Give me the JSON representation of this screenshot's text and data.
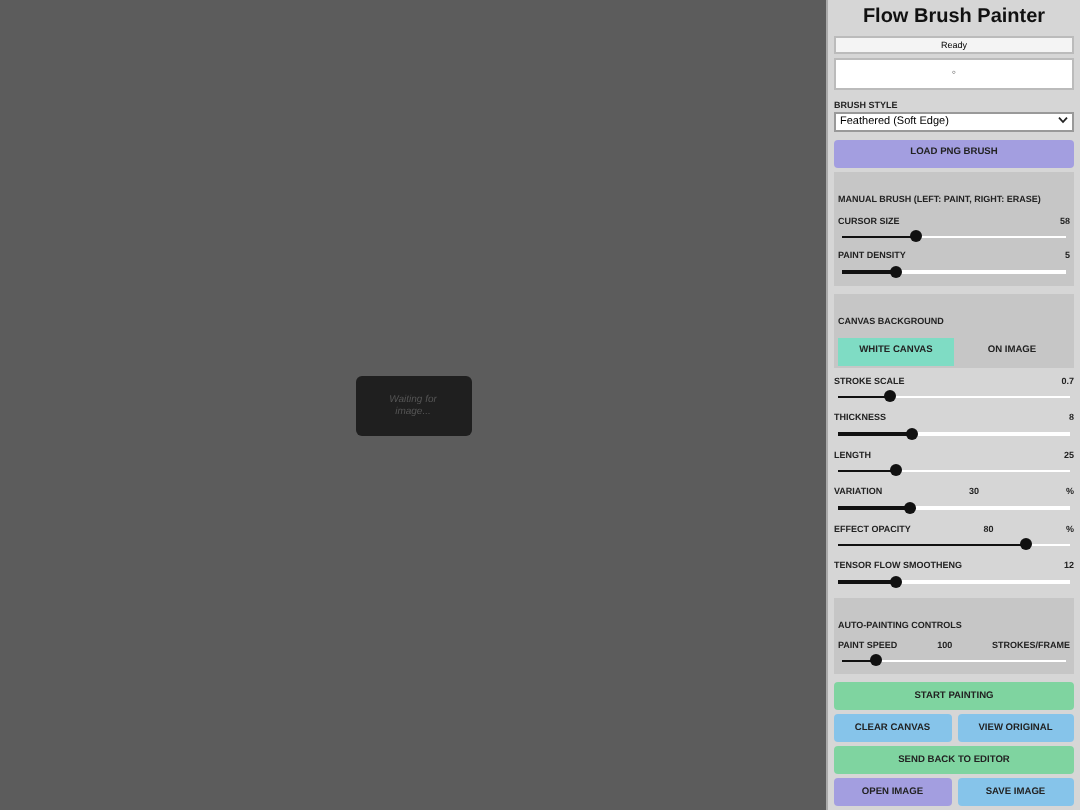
{
  "canvas": {
    "message": "Waiting for image..."
  },
  "panel": {
    "title": "Flow Brush Painter",
    "status": "Ready",
    "preview_symbol": "◦",
    "brush_style": {
      "label": "BRUSH STYLE",
      "value": "Feathered (Soft Edge)"
    },
    "load_button": "LOAD PNG BRUSH",
    "manual": {
      "heading": "MANUAL BRUSH (LEFT: PAINT, RIGHT: ERASE)",
      "sliders": [
        {
          "label": "CURSOR SIZE",
          "reading": "58",
          "level": 0.33
        },
        {
          "label": "PAINT DENSITY",
          "reading": "5",
          "level": 0.24
        }
      ]
    },
    "canvas_background": {
      "heading": "CANVAS BACKGROUND",
      "options": [
        {
          "label": "WHITE CANVAS",
          "selected": true
        },
        {
          "label": "ON IMAGE",
          "selected": false
        }
      ]
    },
    "sliders": [
      {
        "label": "STROKE SCALE",
        "reading": "0.7",
        "level": 0.22
      },
      {
        "label": "THICKNESS",
        "reading": "8",
        "level": 0.32
      },
      {
        "label": "LENGTH",
        "reading": "25",
        "level": 0.25
      },
      {
        "label": "VARIATION",
        "reading": "30",
        "unit": "%",
        "level": 0.31
      },
      {
        "label": "EFFECT OPACITY",
        "reading": "80",
        "unit": "%",
        "level": 0.81
      },
      {
        "label": "TENSOR FLOW SMOOTHENG",
        "reading": "12",
        "level": 0.25
      }
    ],
    "auto": {
      "heading": "AUTO-PAINTING CONTROLS",
      "label": "PAINT SPEED",
      "reading": "100",
      "unit": "STROKES/FRAME",
      "level": 0.15
    },
    "buttons": [
      [
        {
          "label": "START PAINTING",
          "kind": "green"
        }
      ],
      [
        {
          "label": "CLEAR CANVAS",
          "kind": "blue"
        },
        {
          "label": "VIEW ORIGINAL",
          "kind": "blue"
        }
      ],
      [
        {
          "label": "SEND BACK TO EDITOR",
          "kind": "green"
        }
      ],
      [
        {
          "label": "OPEN IMAGE",
          "kind": "purple"
        },
        {
          "label": "SAVE IMAGE",
          "kind": "blue"
        }
      ]
    ]
  }
}
